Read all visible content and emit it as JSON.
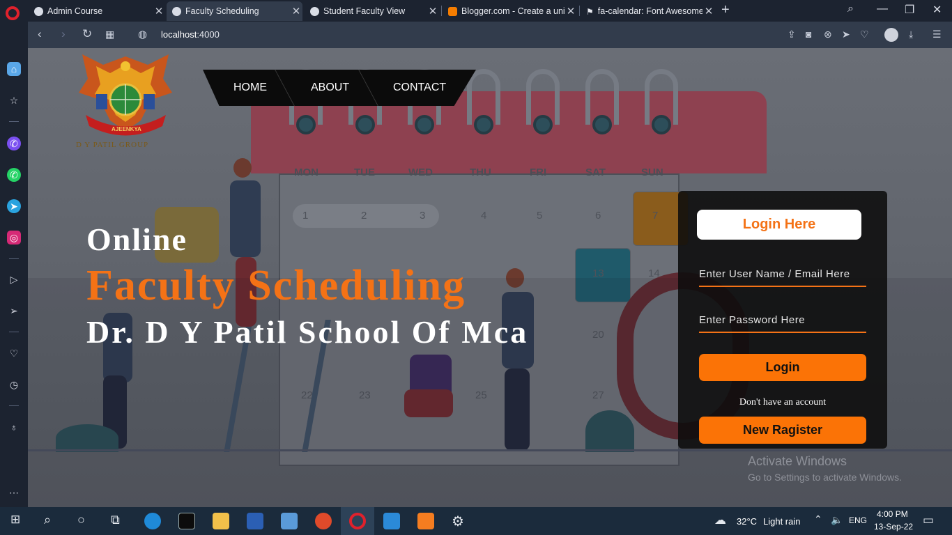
{
  "browser": {
    "tabs": [
      {
        "title": "Admin Course",
        "active": false
      },
      {
        "title": "Faculty Scheduling",
        "active": true
      },
      {
        "title": "Student Faculty View",
        "active": false
      },
      {
        "title": "Blogger.com - Create a uni",
        "active": false
      },
      {
        "title": "fa-calendar: Font Awesome",
        "active": false
      }
    ],
    "url_host": "localhost",
    "url_port": ":4000"
  },
  "page": {
    "logo_text": "AJEENKYA",
    "logo_subtext": "D Y PATIL GROUP",
    "nav": {
      "home": "HOME",
      "about": "ABOUT",
      "contact": "CONTACT"
    },
    "hero": {
      "line1": "Online",
      "line2": "Faculty Scheduling",
      "line3": "Dr. D Y Patil School Of Mca"
    },
    "calendar_days": [
      "MON",
      "TUE",
      "WED",
      "THU",
      "FRI",
      "SAT",
      "SUN"
    ],
    "calendar_numbers": [
      "1",
      "2",
      "3",
      "4",
      "5",
      "6",
      "7",
      "13",
      "14",
      "20",
      "22",
      "23",
      "25",
      "27"
    ],
    "login": {
      "title": "Login Here",
      "username_placeholder": "Enter User Name / Email Here",
      "password_placeholder": "Enter Password Here",
      "login_button": "Login",
      "no_account_text": "Don't have an account",
      "register_button": "New Ragister"
    },
    "activate_windows": {
      "title": "Activate Windows",
      "subtitle": "Go to Settings to activate Windows."
    }
  },
  "taskbar": {
    "weather": "32°C",
    "weather_desc": "Light rain",
    "lang": "ENG",
    "time": "4:00 PM",
    "date": "13-Sep-22"
  },
  "colors": {
    "accent": "#f47216",
    "button": "#fb7306",
    "panel": "#0c0c0c"
  }
}
